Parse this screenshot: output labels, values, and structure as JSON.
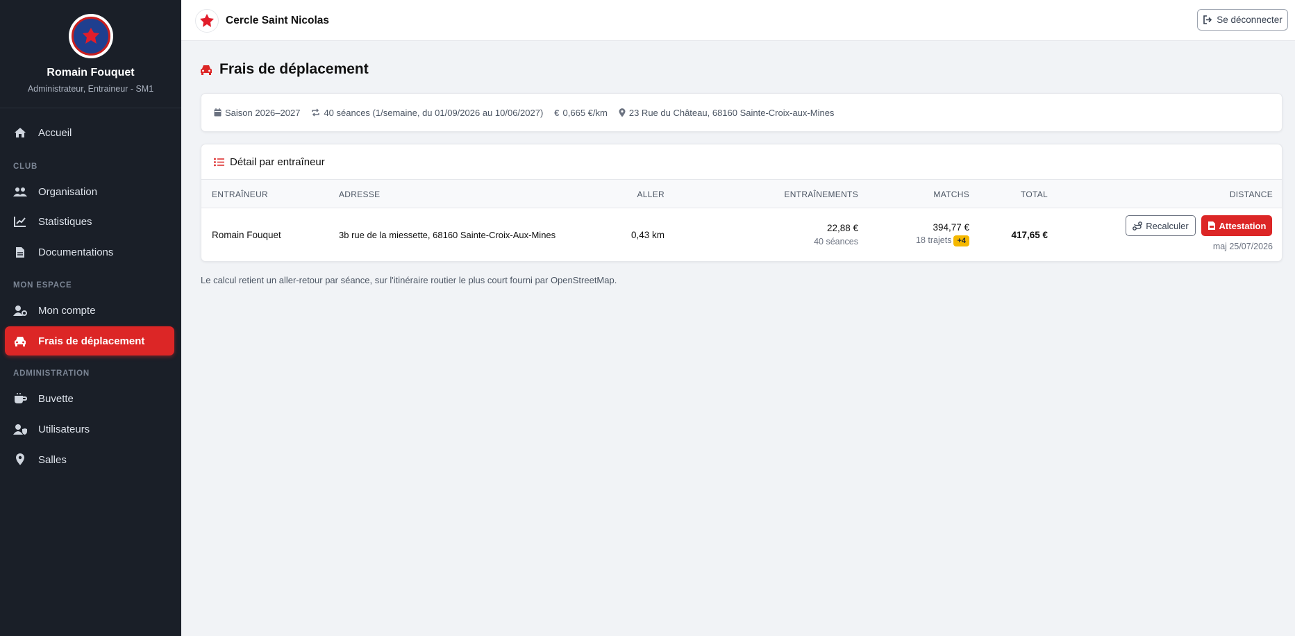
{
  "profile": {
    "name": "Romain Fouquet",
    "role": "Administrateur, Entraineur - SM1"
  },
  "nav": {
    "home": "Accueil",
    "section_club": "CLUB",
    "organisation": "Organisation",
    "statistiques": "Statistiques",
    "documentations": "Documentations",
    "section_mon_espace": "MON ESPACE",
    "mon_compte": "Mon compte",
    "frais": "Frais de déplacement",
    "section_admin": "ADMINISTRATION",
    "buvette": "Buvette",
    "utilisateurs": "Utilisateurs",
    "salles": "Salles"
  },
  "topbar": {
    "club_name": "Cercle Saint Nicolas",
    "logout_label": "Se déconnecter"
  },
  "page": {
    "title": "Frais de déplacement"
  },
  "info": {
    "season": "Saison 2026–2027",
    "sessions": "40 séances (1/semaine, du 01/09/2026 au 10/06/2027)",
    "rate": "0,665 €/km",
    "address": "23 Rue du Château, 68160 Sainte-Croix-aux-Mines"
  },
  "detail": {
    "title": "Détail par entraîneur",
    "columns": {
      "coach": "Entraîneur",
      "address": "Adresse",
      "aller": "Aller",
      "trainings": "Entraînements",
      "matchs": "Matchs",
      "total": "Total",
      "distance": "Distance"
    },
    "rows": [
      {
        "coach": "Romain Fouquet",
        "address": "3b rue de la miessette, 68160 Sainte-Croix-Aux-Mines",
        "aller": "0,43 km",
        "trainings_amount": "22,88 €",
        "trainings_count": "40 séances",
        "matchs_amount": "394,77 €",
        "matchs_trips": "18 trajets",
        "matchs_badge": "+4",
        "total": "417,65 €",
        "recalc_label": "Recalculer",
        "attestation_label": "Attestation",
        "updated": "maj 25/07/2026"
      }
    ]
  },
  "footnote": "Le calcul retient un aller-retour par séance, sur l'itinéraire routier le plus court fourni par OpenStreetMap.",
  "colors": {
    "accent": "#dc2626",
    "sidebar_bg": "#1a1f28",
    "badge": "#f5b800"
  }
}
